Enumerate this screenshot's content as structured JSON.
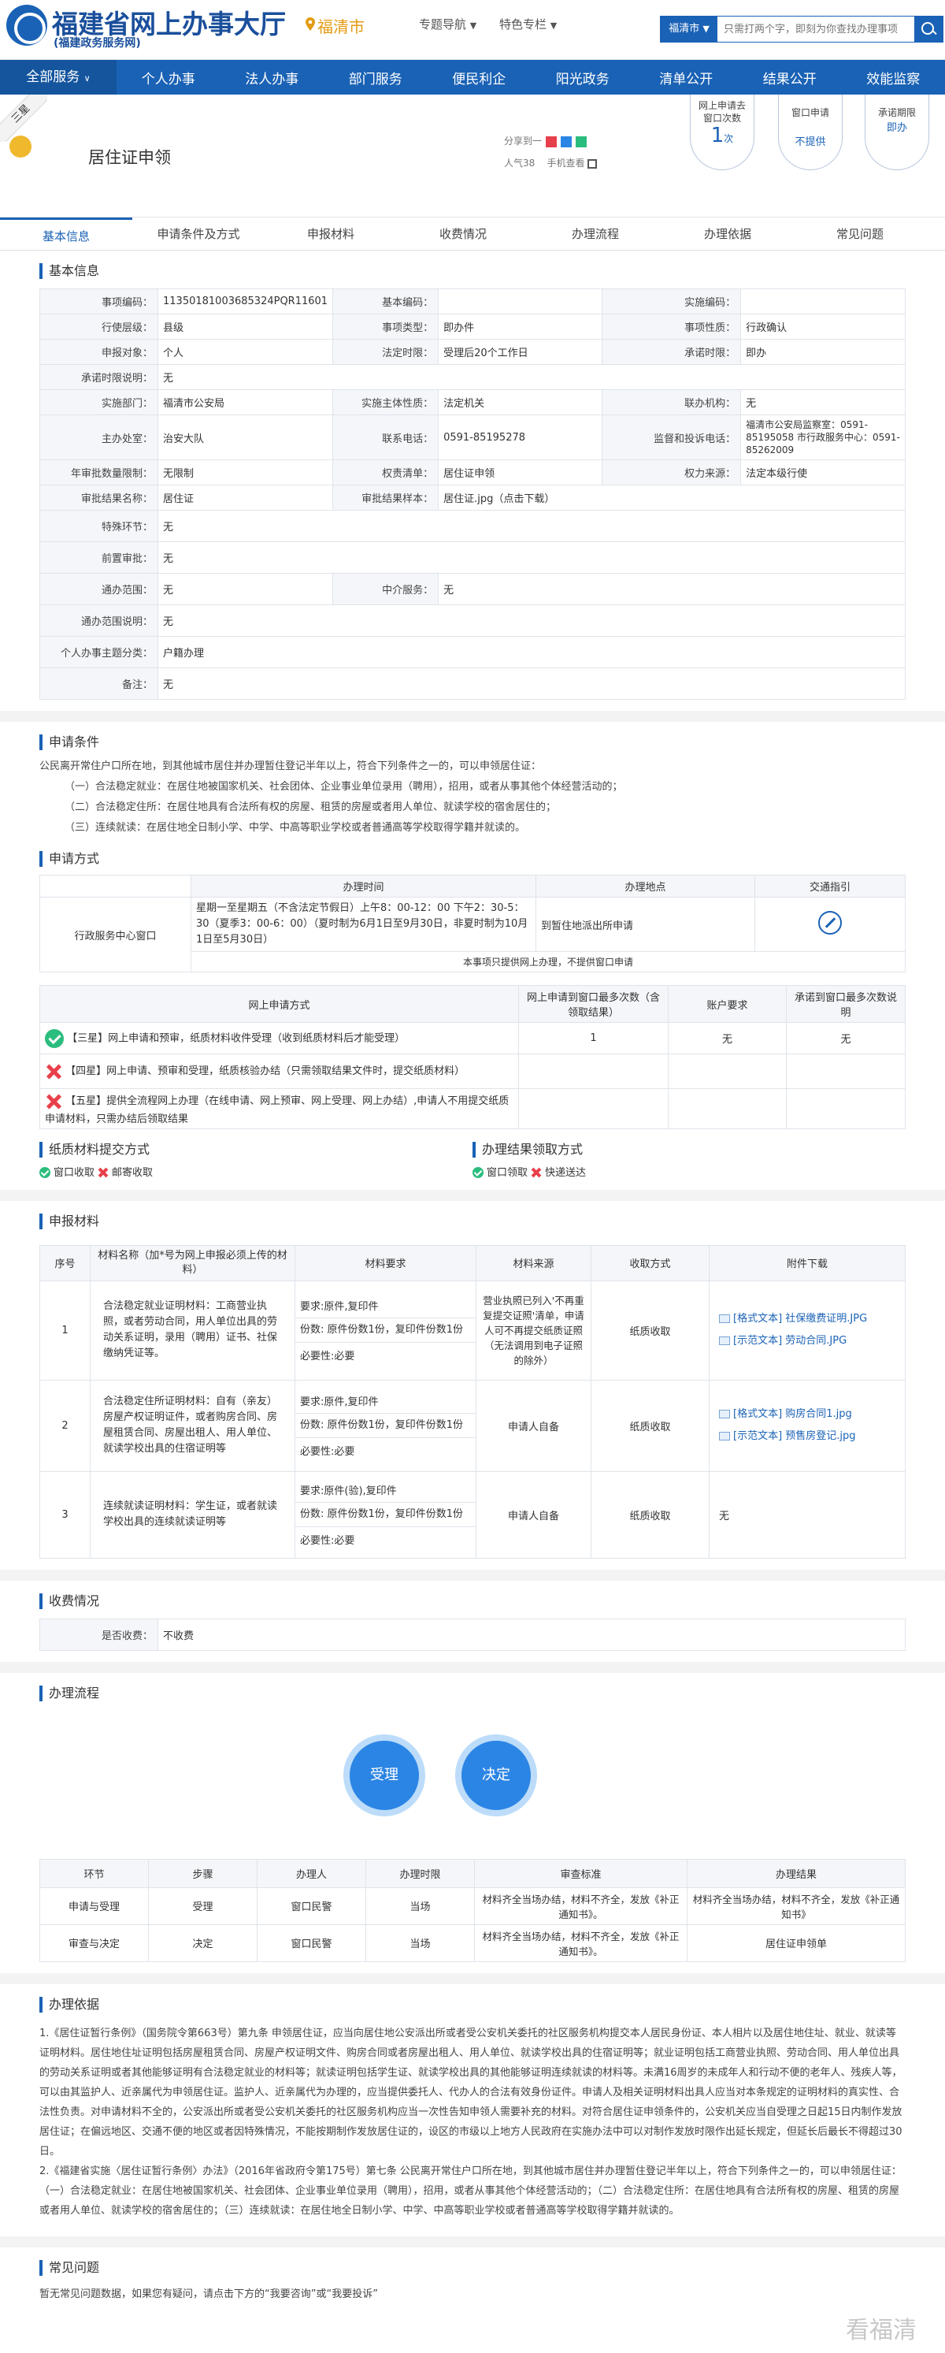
{
  "header": {
    "site_title": "福建省网上办事大厅",
    "site_subtitle": "(福建政务服务网)",
    "city": "福清市",
    "topic_nav": "专题导航",
    "special_col": "特色专栏",
    "search_scope": "福清市",
    "search_placeholder": "只需打两个字，即刻为你查找办理事项"
  },
  "nav": {
    "all": "全部服务",
    "items": [
      "个人办事",
      "法人办事",
      "部门服务",
      "便民利企",
      "阳光政务",
      "清单公开",
      "结果公开",
      "效能监察"
    ]
  },
  "service": {
    "star": "三星",
    "name": "居住证申领",
    "share_label": "分享到一",
    "popularity": "人气38",
    "mobile": "手机查看",
    "online_label": "网上申请去窗口次数",
    "online_count": "1",
    "online_unit": "次",
    "window_label": "窗口申请",
    "window_value": "不提供",
    "limit_label": "承诺期限",
    "limit_value": "即办"
  },
  "tabs": [
    "基本信息",
    "申请条件及方式",
    "申报材料",
    "收费情况",
    "办理流程",
    "办理依据",
    "常见问题"
  ],
  "basic": {
    "title": "基本信息",
    "rows": [
      [
        "事项编码：",
        "11350181003685324PQR11601",
        "基本编码：",
        "",
        "实施编码：",
        ""
      ],
      [
        "行使层级：",
        "县级",
        "事项类型：",
        "即办件",
        "事项性质：",
        "行政确认"
      ],
      [
        "申报对象：",
        "个人",
        "法定时限：",
        "受理后20个工作日",
        "承诺时限：",
        "即办"
      ],
      [
        "承诺时限说明：",
        "无"
      ],
      [
        "实施部门：",
        "福清市公安局",
        "实施主体性质：",
        "法定机关",
        "联办机构：",
        "无"
      ],
      [
        "主办处室：",
        "治安大队",
        "联系电话：",
        "0591-85195278",
        "监督和投诉电话：",
        "福清市公安局监察室：0591-85195058 市行政服务中心：0591-85262009"
      ],
      [
        "年审批数量限制：",
        "无限制",
        "权责清单：",
        "居住证申领",
        "权力来源：",
        "法定本级行使"
      ],
      [
        "审批结果名称：",
        "居住证",
        "审批结果样本：",
        "居住证.jpg（点击下载）"
      ],
      [
        "特殊环节：",
        "无"
      ],
      [
        "前置审批：",
        "无"
      ],
      [
        "通办范围：",
        "无",
        "中介服务：",
        "无"
      ],
      [
        "通办范围说明：",
        "无"
      ],
      [
        "个人办事主题分类：",
        "户籍办理"
      ],
      [
        "备注：",
        "无"
      ]
    ]
  },
  "conditions": {
    "title": "申请条件",
    "intro": "公民离开常住户口所在地，到其他城市居住并办理暂住登记半年以上，符合下列条件之一的，可以申领居住证：",
    "items": [
      "（一）合法稳定就业：在居住地被国家机关、社会团体、企业事业单位录用（聘用），招用，或者从事其他个体经营活动的；",
      "（二）合法稳定住所：在居住地具有合法所有权的房屋、租赁的房屋或者用人单位、就读学校的宿舍居住的；",
      "（三）连续就读：在居住地全日制小学、中学、中高等职业学校或者普通高等学校取得学籍并就读的。"
    ]
  },
  "method": {
    "title": "申请方式",
    "window_headers": [
      "办理时间",
      "办理地点",
      "交通指引"
    ],
    "window_name": "行政服务中心窗口",
    "window_time": "星期一至星期五（不含法定节假日）上午8：00-12：00 下午2：30-5：30（夏季3：00-6：00）（夏时制为6月1日至9月30日，非夏时制为10月1日至5月30日）",
    "window_place": "到暂住地派出所申请",
    "window_note": "本事项只提供网上办理，不提供窗口申请",
    "online_headers": [
      "网上申请方式",
      "网上申请到窗口最多次数（含领取结果）",
      "账户要求",
      "承诺到窗口最多次数说明"
    ],
    "online_rows": [
      {
        "label": "【三星】网上申请和预审，纸质材料收件受理（收到纸质材料后才能受理）",
        "count": "1",
        "account": "无",
        "note": "无",
        "ok": true
      },
      {
        "label": "【四星】网上申请、预审和受理，纸质核验办结（只需领取结果文件时，提交纸质材料）",
        "count": "",
        "account": "",
        "note": "",
        "ok": false
      },
      {
        "label": "【五星】提供全流程网上办理（在线申请、网上预审、网上受理、网上办结）,申请人不用提交纸质申请材料，只需办结后领取结果",
        "count": "",
        "account": "",
        "note": "",
        "ok": false
      }
    ],
    "paper_title": "纸质材料提交方式",
    "paper_ok": "窗口收取",
    "paper_no": "邮寄收取",
    "result_title": "办理结果领取方式",
    "result_ok": "窗口领取",
    "result_no": "快递送达"
  },
  "materials": {
    "title": "申报材料",
    "headers": [
      "序号",
      "材料名称（加*号为网上申报必须上传的材料）",
      "材料要求",
      "材料来源",
      "收取方式",
      "附件下载"
    ],
    "rows": [
      {
        "no": "1",
        "name": "合法稳定就业证明材料：工商营业执照，或者劳动合同，用人单位出具的劳动关系证明，录用（聘用）证书、社保缴纳凭证等。",
        "req": [
          "要求:原件,复印件",
          "份数: 原件份数1份，复印件份数1份",
          "必要性:必要"
        ],
        "source": "营业执照已列入'不再重复提交证照'清单，申请人可不再提交纸质证照（无法调用到电子证照的除外）",
        "method": "纸质收取",
        "files": [
          "[格式文本] 社保缴费证明.JPG",
          "[示范文本] 劳动合同.JPG"
        ]
      },
      {
        "no": "2",
        "name": "合法稳定住所证明材料：自有（亲友）房屋产权证明证件，或者购房合同、房屋租赁合同、房屋出租人、用人单位、就读学校出具的住宿证明等",
        "req": [
          "要求:原件,复印件",
          "份数: 原件份数1份，复印件份数1份",
          "必要性:必要"
        ],
        "source": "申请人自备",
        "method": "纸质收取",
        "files": [
          "[格式文本] 购房合同1.jpg",
          "[示范文本] 预售房登记.jpg"
        ]
      },
      {
        "no": "3",
        "name": "连续就读证明材料：学生证，或者就读学校出具的连续就读证明等",
        "req": [
          "要求:原件(验),复印件",
          "份数: 原件份数1份，复印件份数1份",
          "必要性:必要"
        ],
        "source": "申请人自备",
        "method": "纸质收取",
        "files": [
          "无"
        ]
      }
    ]
  },
  "fees": {
    "title": "收费情况",
    "label": "是否收费：",
    "value": "不收费"
  },
  "process": {
    "title": "办理流程",
    "steps": [
      "受理",
      "决定"
    ],
    "headers": [
      "环节",
      "步骤",
      "办理人",
      "办理时限",
      "审查标准",
      "办理结果"
    ],
    "rows": [
      [
        "申请与受理",
        "受理",
        "窗口民警",
        "当场",
        "材料齐全当场办结，材料不齐全，发放《补正通知书》。",
        "材料齐全当场办结，材料不齐全，发放《补正通知书》"
      ],
      [
        "审查与决定",
        "决定",
        "窗口民警",
        "当场",
        "材料齐全当场办结，材料不齐全，发放《补正通知书》。",
        "居住证申领单"
      ]
    ]
  },
  "basis": {
    "title": "办理依据",
    "p1": "1.《居住证暂行条例》（国务院令第663号）第九条 申领居住证，应当向居住地公安派出所或者受公安机关委托的社区服务机构提交本人居民身份证、本人相片以及居住地住址、就业、就读等证明材料。居住地住址证明包括房屋租赁合同、房屋产权证明文件、购房合同或者房屋出租人、用人单位、就读学校出具的住宿证明等；就业证明包括工商营业执照、劳动合同、用人单位出具的劳动关系证明或者其他能够证明有合法稳定就业的材料等；就读证明包括学生证、就读学校出具的其他能够证明连续就读的材料等。未满16周岁的未成年人和行动不便的老年人、残疾人等，可以由其监护人、近亲属代为申领居住证。监护人、近亲属代为办理的，应当提供委托人、代办人的合法有效身份证件。申请人及相关证明材料出具人应当对本条规定的证明材料的真实性、合法性负责。对申请材料不全的，公安派出所或者受公安机关委托的社区服务机构应当一次性告知申领人需要补充的材料。对符合居住证申领条件的，公安机关应当自受理之日起15日内制作发放居住证；在偏远地区、交通不便的地区或者因特殊情况，不能按期制作发放居住证的，设区的市级以上地方人民政府在实施办法中可以对制作发放时限作出延长规定，但延长后最长不得超过30日。",
    "p2": "2.《福建省实施〈居住证暂行条例〉办法》（2016年省政府令第175号）第七条 公民离开常住户口所在地，到其他城市居住并办理暂住登记半年以上，符合下列条件之一的，可以申领居住证：（一）合法稳定就业：在居住地被国家机关、社会团体、企业事业单位录用（聘用），招用，或者从事其他个体经营活动的；（二）合法稳定住所：在居住地具有合法所有权的房屋、租赁的房屋或者用人单位、就读学校的宿舍居住的；（三）连续就读：在居住地全日制小学、中学、中高等职业学校或者普通高等学校取得学籍并就读的。"
  },
  "faq": {
    "title": "常见问题",
    "text": "暂无常见问题数据，如果您有疑问，请点击下方的“我要咨询”或“我要投诉”"
  },
  "watermark": "看福清"
}
